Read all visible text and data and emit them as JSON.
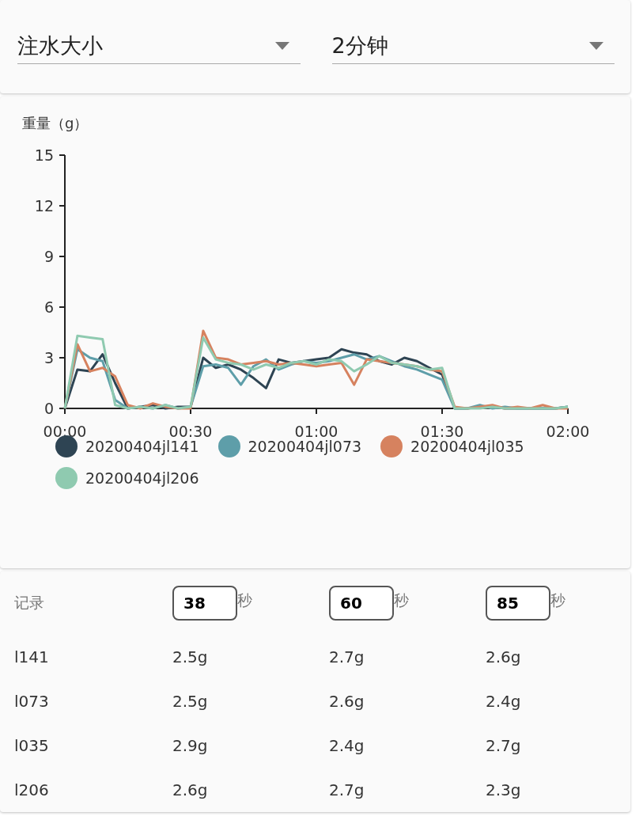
{
  "selects": [
    {
      "value": "注水大小"
    },
    {
      "value": "2分钟"
    }
  ],
  "chart": {
    "chart_data": {
      "type": "line",
      "legend": true,
      "ylabel": "重量（g）",
      "x": [
        0,
        3,
        6,
        9,
        12,
        15,
        18,
        21,
        24,
        27,
        30,
        33,
        36,
        39,
        42,
        45,
        48,
        51,
        54,
        57,
        60,
        63,
        66,
        69,
        72,
        75,
        78,
        81,
        84,
        87,
        90,
        93,
        96,
        99,
        102,
        105,
        108,
        111,
        114,
        117,
        120
      ],
      "xlim": [
        0,
        120
      ],
      "ylim": [
        0,
        15
      ],
      "xticks": [
        {
          "value": 0,
          "label": "00:00"
        },
        {
          "value": 30,
          "label": "00:30"
        },
        {
          "value": 60,
          "label": "01:00"
        },
        {
          "value": 90,
          "label": "01:30"
        },
        {
          "value": 120,
          "label": "02:00"
        }
      ],
      "yticks": [
        0,
        3,
        6,
        9,
        12,
        15
      ],
      "series": [
        {
          "name": "20200404jl141",
          "color": "#2e4453",
          "values": [
            0,
            2.3,
            2.2,
            3.2,
            1.5,
            0,
            0.1,
            0.2,
            0,
            0.1,
            0.1,
            3.0,
            2.4,
            2.6,
            2.3,
            1.8,
            1.2,
            2.9,
            2.7,
            2.8,
            2.9,
            3.0,
            3.5,
            3.3,
            3.2,
            2.8,
            2.6,
            3.0,
            2.8,
            2.4,
            2.0,
            0,
            0,
            0.1,
            0.1,
            0,
            0,
            0,
            0,
            0,
            0.1
          ]
        },
        {
          "name": "20200404jl073",
          "color": "#5e9ea9",
          "values": [
            0,
            3.5,
            3.0,
            2.8,
            0.5,
            0,
            0.1,
            0,
            0.2,
            0,
            0.1,
            2.5,
            2.6,
            2.4,
            1.4,
            2.5,
            2.9,
            2.3,
            2.6,
            2.8,
            2.7,
            2.8,
            3.0,
            3.2,
            2.9,
            3.1,
            2.8,
            2.5,
            2.3,
            2.0,
            1.7,
            0,
            0,
            0.2,
            0,
            0.1,
            0,
            0,
            0,
            0,
            0.1
          ]
        },
        {
          "name": "20200404jl035",
          "color": "#d6825f",
          "values": [
            0,
            3.8,
            2.2,
            2.4,
            1.9,
            0.2,
            0,
            0.3,
            0.1,
            0,
            0,
            4.6,
            3.0,
            2.9,
            2.6,
            2.7,
            2.8,
            2.6,
            2.7,
            2.6,
            2.5,
            2.6,
            2.7,
            1.4,
            2.9,
            2.8,
            2.7,
            2.6,
            2.5,
            2.3,
            2.2,
            0.1,
            0,
            0.1,
            0.2,
            0,
            0.1,
            0,
            0.2,
            0,
            0
          ]
        },
        {
          "name": "20200404jl206",
          "color": "#8fcab0",
          "values": [
            0,
            4.3,
            4.2,
            4.1,
            0.2,
            0,
            0.1,
            0,
            0.2,
            0,
            0.1,
            4.2,
            2.9,
            2.7,
            2.6,
            2.3,
            2.6,
            2.4,
            2.7,
            2.8,
            2.6,
            2.9,
            2.8,
            2.2,
            2.6,
            3.1,
            2.7,
            2.6,
            2.5,
            2.3,
            2.4,
            0,
            0,
            0,
            0.1,
            0,
            0,
            0,
            0,
            0,
            0.1
          ]
        }
      ]
    }
  },
  "table": {
    "header_label": "记录",
    "time_inputs": [
      {
        "value": "38",
        "unit": "秒"
      },
      {
        "value": "60",
        "unit": "秒"
      },
      {
        "value": "85",
        "unit": "秒"
      }
    ],
    "rows": [
      {
        "name": "l141",
        "cells": [
          "2.5g",
          "2.7g",
          "2.6g"
        ]
      },
      {
        "name": "l073",
        "cells": [
          "2.5g",
          "2.6g",
          "2.4g"
        ]
      },
      {
        "name": "l035",
        "cells": [
          "2.9g",
          "2.4g",
          "2.7g"
        ]
      },
      {
        "name": "l206",
        "cells": [
          "2.6g",
          "2.7g",
          "2.3g"
        ]
      }
    ]
  }
}
